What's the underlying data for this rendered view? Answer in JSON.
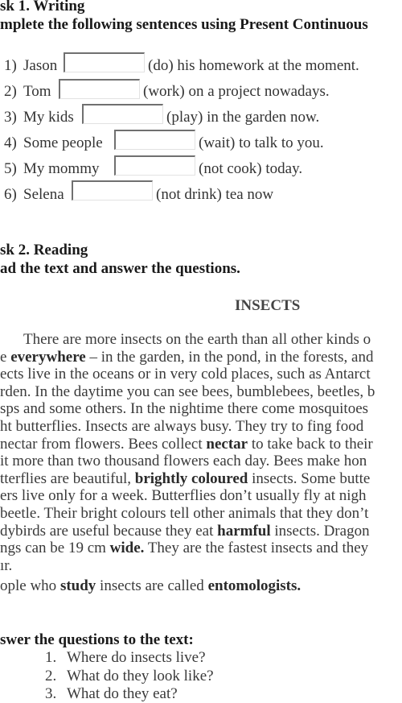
{
  "task1": {
    "title": "sk 1. Writing",
    "instruction": "mplete the following sentences using Present Continuous",
    "exercises": [
      {
        "num": "1)",
        "subject": "Jason",
        "answer": "",
        "rest": "(do) his homework at the moment."
      },
      {
        "num": "2)",
        "subject": "Tom",
        "answer": "",
        "rest": "(work) on a project nowadays."
      },
      {
        "num": "3)",
        "subject": "My kids",
        "answer": "",
        "rest": "(play) in the garden now."
      },
      {
        "num": "4)",
        "subject": "Some people",
        "answer": "",
        "rest": "(wait) to talk to you."
      },
      {
        "num": "5)",
        "subject": "My mommy",
        "answer": "",
        "rest": "(not cook) today."
      },
      {
        "num": "6)",
        "subject": "Selena",
        "answer": "",
        "rest": "(not drink) tea now"
      }
    ]
  },
  "task2": {
    "title": "sk 2. Reading",
    "instruction": "ad the text and answer the questions.",
    "text_title": "INSECTS",
    "paragraph_lines": [
      [
        {
          "t": "There are more insects on the earth than all other kinds o"
        }
      ],
      [
        {
          "t": "e "
        },
        {
          "b": "everywhere"
        },
        {
          "t": " – in the garden, in the pond, in the forests, and"
        }
      ],
      [
        {
          "t": "ects live in the oceans or in very cold places, such as Antarct"
        }
      ],
      [
        {
          "t": "rden. In the daytime you can see bees, bumblebees, beetles, b"
        }
      ],
      [
        {
          "t": "sps and some others. In the nightime there come mosquitoes"
        }
      ],
      [
        {
          "t": "ht butterflies.  Insects are always busy. They try to fing food"
        }
      ],
      [
        {
          "t": "nectar from flowers. Bees collect "
        },
        {
          "b": "nectar"
        },
        {
          "t": " to take back to their"
        }
      ],
      [
        {
          "t": "it more than two thousand flowers each day. Bees make hon"
        }
      ],
      [
        {
          "t": "tterflies are beautiful, "
        },
        {
          "b": "brightly coloured"
        },
        {
          "t": " insects. Some butte"
        }
      ],
      [
        {
          "t": "ers live only for a week. Butterflies don’t usually fly at nigh"
        }
      ],
      [
        {
          "t": "beetle. Their bright colours tell other animals that they don’t"
        }
      ],
      [
        {
          "t": "dybirds are useful because they eat "
        },
        {
          "b": "harmful"
        },
        {
          "t": " insects. Dragon"
        }
      ],
      [
        {
          "t": "ngs can be 19 cm "
        },
        {
          "b": "wide."
        },
        {
          "t": " They are the fastest insects and they"
        }
      ],
      [
        {
          "t": "ır."
        }
      ],
      [
        {
          "t": "ople who "
        },
        {
          "b": "study"
        },
        {
          "t": " insects are called "
        },
        {
          "b": "entomologists."
        }
      ]
    ],
    "questions_title": "swer the questions to the text:",
    "questions": [
      {
        "num": "1.",
        "text": "Where do insects live?"
      },
      {
        "num": "2.",
        "text": "What do they look like?"
      },
      {
        "num": "3.",
        "text": "What do they eat?"
      }
    ]
  }
}
